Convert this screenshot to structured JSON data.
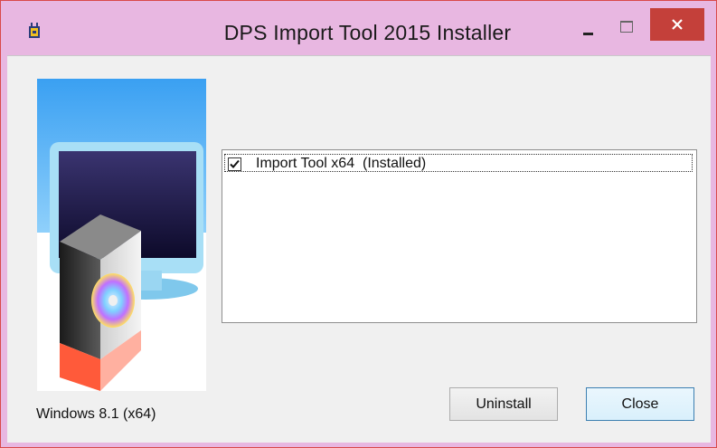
{
  "window": {
    "title": "DPS Import Tool 2015 Installer",
    "controls": {
      "minimize": "minimize",
      "maximize": "maximize",
      "close": "close"
    },
    "close_color": "#c4403a",
    "frame_color": "#e8b7e1"
  },
  "sidebar": {
    "image": "computer-monitor-with-installer-box-and-disc",
    "os_label": "Windows 8.1 (x64)"
  },
  "components": {
    "items": [
      {
        "label": "Import Tool x64  (Installed)",
        "checked": true
      }
    ]
  },
  "buttons": {
    "uninstall": "Uninstall",
    "close": "Close"
  }
}
